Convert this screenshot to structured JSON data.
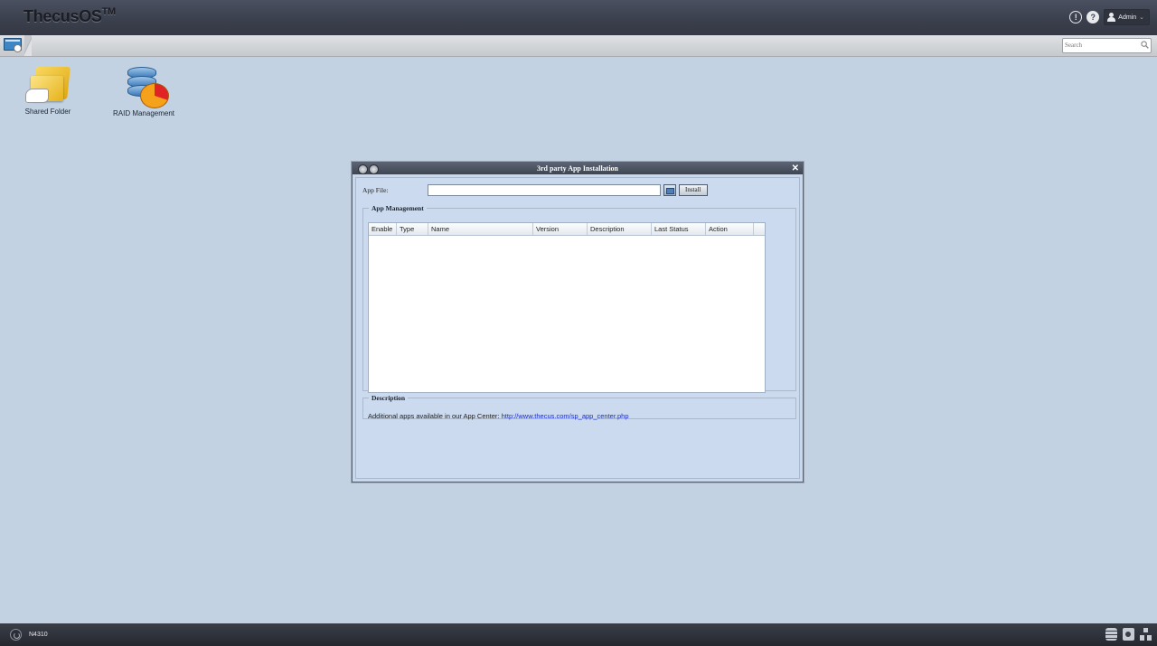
{
  "header": {
    "brand": "ThecusOS",
    "brand_tm": "TM",
    "user_label": "Admin"
  },
  "toolbar": {
    "search_placeholder": "Search"
  },
  "desktop": {
    "icons": [
      {
        "label": "Shared Folder",
        "icon": "shared-folder-icon"
      },
      {
        "label": "RAID Management",
        "icon": "raid-management-icon"
      }
    ]
  },
  "dialog": {
    "title": "3rd party App Installation",
    "app_file_label": "App File:",
    "app_file_value": "",
    "install_label": "Install",
    "app_management_legend": "App Management",
    "columns": [
      "Enable",
      "Type",
      "Name",
      "Version",
      "Description",
      "Last Status",
      "Action"
    ],
    "rows": [],
    "description_legend": "Description",
    "description_text": "Additional apps available in our App Center: ",
    "description_link": "http://www.thecus.com/sp_app_center.php"
  },
  "footer": {
    "model": "N4310"
  },
  "colors": {
    "desktop_bg": "#c3d2e2",
    "header_bg": "#3a3f4c",
    "dialog_bg": "#c9d8ec",
    "link": "#1a2ec7"
  }
}
